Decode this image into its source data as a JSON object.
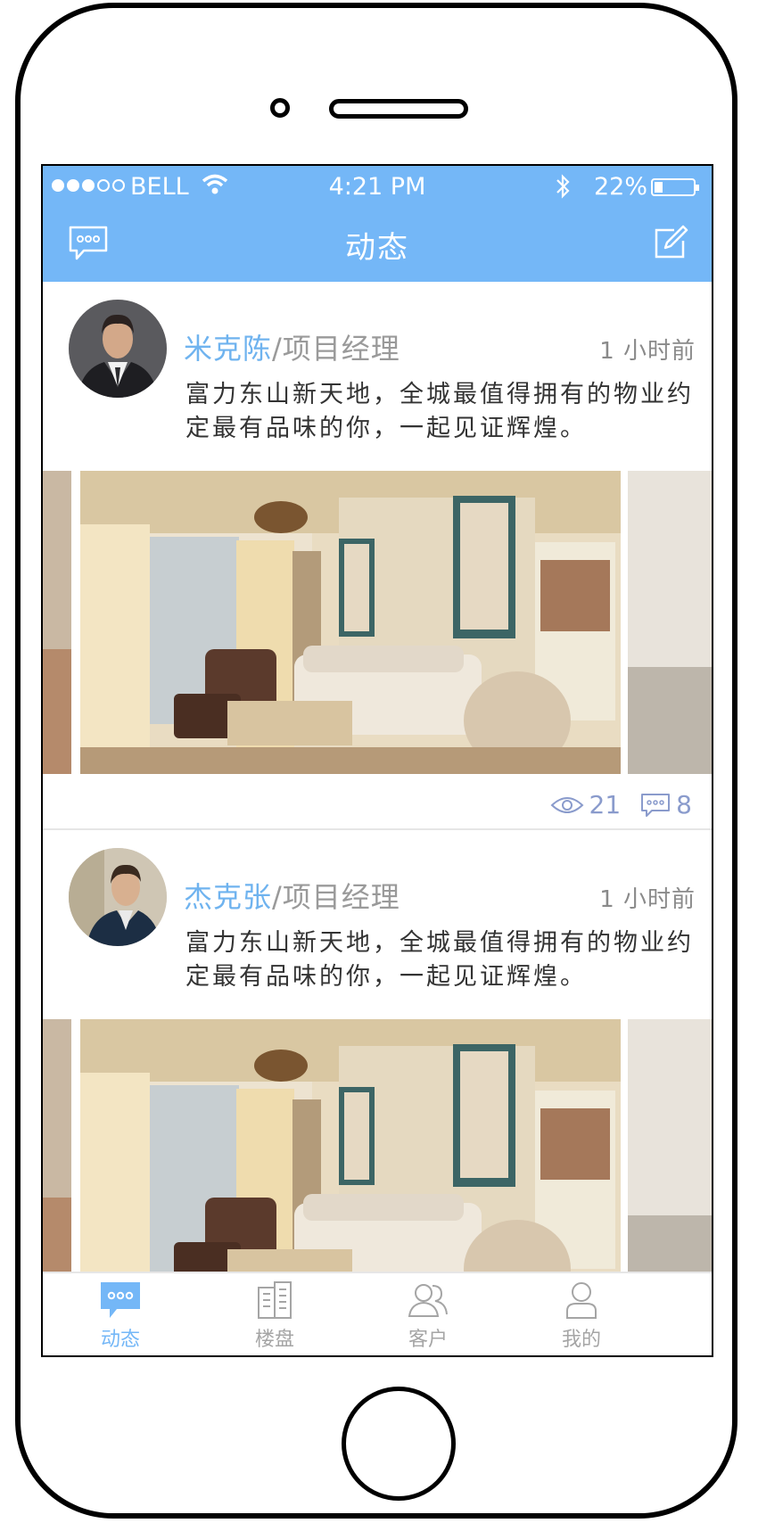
{
  "status_bar": {
    "carrier": "BELL",
    "time": "4:21 PM",
    "battery": "22%",
    "battery_level": 0.22
  },
  "nav": {
    "title": "动态",
    "left_icon": "chat-bubble-icon",
    "right_icon": "edit-icon"
  },
  "posts": [
    {
      "author": "米克陈",
      "separator": "/",
      "role": "项目经理",
      "time": "1 小时前",
      "content": "富力东山新天地，全城最值得拥有的物业约定最有品味的你，一起见证辉煌。",
      "views": "21",
      "comments": "8"
    },
    {
      "author": "杰克张",
      "separator": "/",
      "role": "项目经理",
      "time": "1 小时前",
      "content": "富力东山新天地，全城最值得拥有的物业约定最有品味的你，一起见证辉煌。"
    }
  ],
  "tabs": [
    {
      "label": "动态",
      "icon": "chat-bubble-icon",
      "active": true
    },
    {
      "label": "楼盘",
      "icon": "building-icon",
      "active": false
    },
    {
      "label": "客户",
      "icon": "customers-icon",
      "active": false
    },
    {
      "label": "我的",
      "icon": "profile-icon",
      "active": false
    }
  ],
  "colors": {
    "accent": "#74b7f7",
    "stats": "#8a9bcc"
  }
}
